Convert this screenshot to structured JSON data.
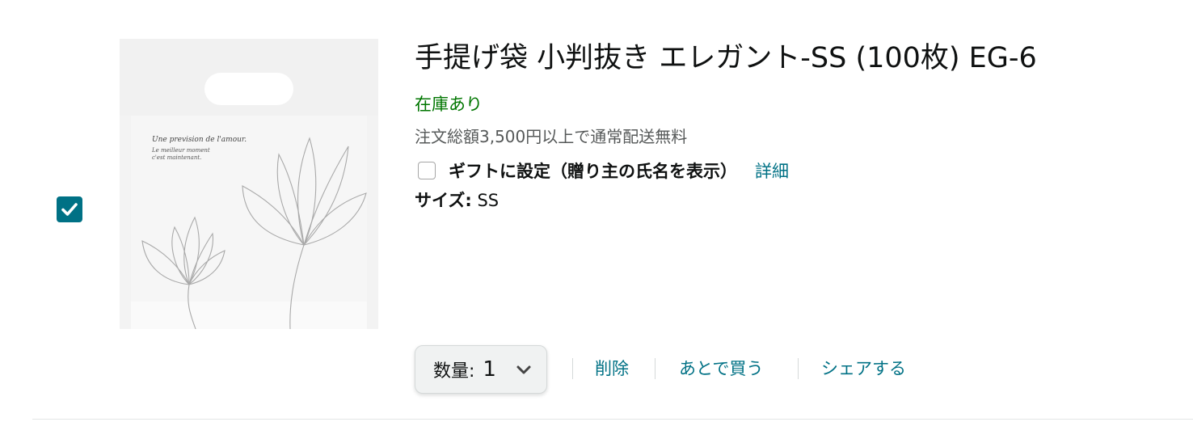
{
  "item": {
    "title": "手提げ袋 小判抜き エレガント-SS (100枚) EG-6",
    "selected": true,
    "image": {
      "line1": "Une prevision de l'amour.",
      "line2": "Le meilleur moment",
      "line3": "c'est maintenant."
    },
    "stock_status": "在庫あり",
    "shipping_note": "注文総額3,500円以上で通常配送無料",
    "gift": {
      "checked": false,
      "label": "ギフトに設定（贈り主の氏名を表示）",
      "details_link": "詳細"
    },
    "size": {
      "label": "サイズ:",
      "value": "SS"
    }
  },
  "actions": {
    "quantity_label": "数量:",
    "quantity_value": "1",
    "delete": "削除",
    "save_for_later": "あとで買う",
    "share": "シェアする"
  },
  "colors": {
    "link": "#007185",
    "in_stock": "#007600",
    "checkbox_checked": "#007185",
    "secondary_text": "#565959"
  },
  "icons": {
    "select_checkbox": "check-icon",
    "quantity_dropdown": "chevron-down-icon"
  }
}
